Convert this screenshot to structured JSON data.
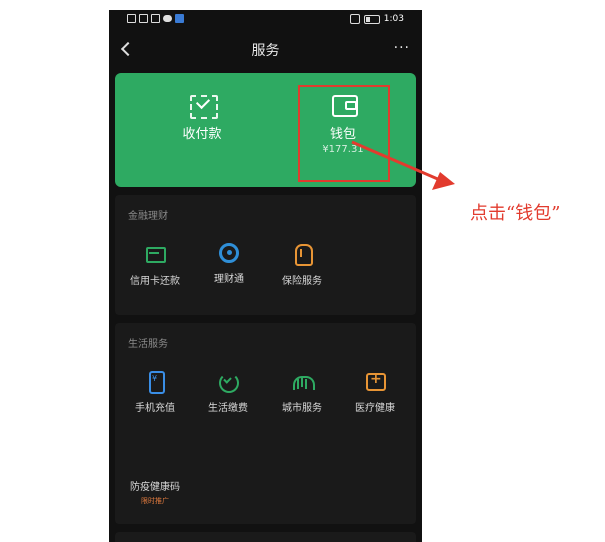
{
  "status_bar": {
    "time": "1:03"
  },
  "header": {
    "title": "服务",
    "more": "···"
  },
  "top_card": {
    "pay": {
      "label": "收付款"
    },
    "wallet": {
      "label": "钱包",
      "balance": "¥177.31"
    }
  },
  "finance": {
    "title": "金融理财",
    "items": [
      {
        "label": "信用卡还款"
      },
      {
        "label": "理财通"
      },
      {
        "label": "保险服务"
      }
    ]
  },
  "life": {
    "title": "生活服务",
    "items": [
      {
        "label": "手机充值"
      },
      {
        "label": "生活缴费"
      },
      {
        "label": "城市服务"
      },
      {
        "label": "医疗健康"
      },
      {
        "label": "防疫健康码",
        "tag": "限时推广"
      }
    ]
  },
  "annotation": {
    "text": "点击“钱包”"
  },
  "colors": {
    "accent_green": "#2eaa62",
    "annotation_red": "#e23b2e",
    "background": "#111111"
  }
}
